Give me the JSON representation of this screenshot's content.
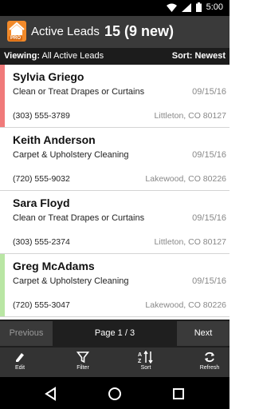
{
  "status": {
    "time": "5:00",
    "wifi_icon": "wifi-icon",
    "signal_icon": "signal-icon",
    "battery_icon": "battery-icon"
  },
  "header": {
    "logo_icon": "house-pro-logo-icon",
    "logo_badge": "PRO",
    "title": "Active Leads",
    "count": "15 (9 new)"
  },
  "viewbar": {
    "viewing_label": "Viewing:",
    "viewing_value": "All Active Leads",
    "sort_label": "Sort:",
    "sort_value": "Newest"
  },
  "leads": [
    {
      "name": "Sylvia Griego",
      "service": "Clean or Treat Drapes or Curtains",
      "date": "09/15/16",
      "phone": "(303) 555-3789",
      "location": "Littleton, CO 80127",
      "stripe": "#f07a7a"
    },
    {
      "name": "Keith Anderson",
      "service": "Carpet & Upholstery Cleaning",
      "date": "09/15/16",
      "phone": "(720) 555-9032",
      "location": "Lakewood, CO 80226",
      "stripe": "#ffffff"
    },
    {
      "name": "Sara Floyd",
      "service": "Clean or Treat Drapes or Curtains",
      "date": "09/15/16",
      "phone": "(303) 555-2374",
      "location": "Littleton, CO 80127",
      "stripe": "#ffffff"
    },
    {
      "name": "Greg McAdams",
      "service": "Carpet & Upholstery Cleaning",
      "date": "09/15/16",
      "phone": "(720) 555-3047",
      "location": "Lakewood, CO 80226",
      "stripe": "#b9e6a4"
    }
  ],
  "pager": {
    "previous": "Previous",
    "page": "Page 1 / 3",
    "next": "Next"
  },
  "toolbar": {
    "edit": "Edit",
    "filter": "Filter",
    "sort": "Sort",
    "refresh": "Refresh"
  },
  "colors": {
    "accent": "#f28a2a",
    "appbar": "#3a3a3a"
  }
}
